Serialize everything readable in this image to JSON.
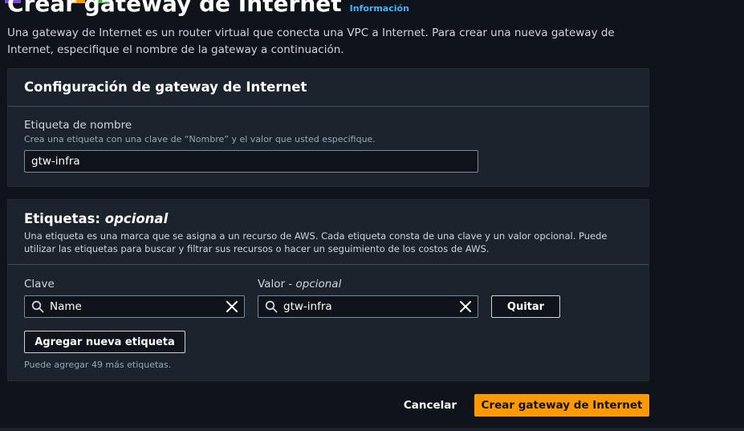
{
  "page": {
    "title": "Crear gateway de Internet",
    "info_link": "Información",
    "description": "Una gateway de Internet es un router virtual que conecta una VPC a Internet. Para crear una nueva gateway de Internet, especifique el nombre de la gateway a continuación."
  },
  "settings_panel": {
    "title": "Configuración de gateway de Internet",
    "name_tag_label": "Etiqueta de nombre",
    "name_tag_hint": "Crea una etiqueta con una clave de “Nombre” y el valor que usted especifique.",
    "name_tag_value": "gtw-infra"
  },
  "tags_panel": {
    "title": "Etiquetas:",
    "title_optional": "opcional",
    "description": "Una etiqueta es una marca que se asigna a un recurso de AWS. Cada etiqueta consta de una clave y un valor opcional. Puede utilizar las etiquetas para buscar y filtrar sus recursos o hacer un seguimiento de los costos de AWS.",
    "key_label": "Clave",
    "value_label": "Valor -",
    "value_optional": "opcional",
    "tags": [
      {
        "key": "Name",
        "value": "gtw-infra"
      }
    ],
    "remove_label": "Quitar",
    "add_label": "Agregar nueva etiqueta",
    "remaining_hint": "Puede agregar 49 más etiquetas."
  },
  "footer": {
    "cancel_label": "Cancelar",
    "create_label": "Crear gateway de Internet"
  },
  "colors": {
    "background": "#0f141a",
    "panel": "#1b232d",
    "accent": "#ff9900",
    "link": "#42b4ff"
  },
  "icons": {
    "search": "search-icon",
    "clear": "close-icon"
  }
}
